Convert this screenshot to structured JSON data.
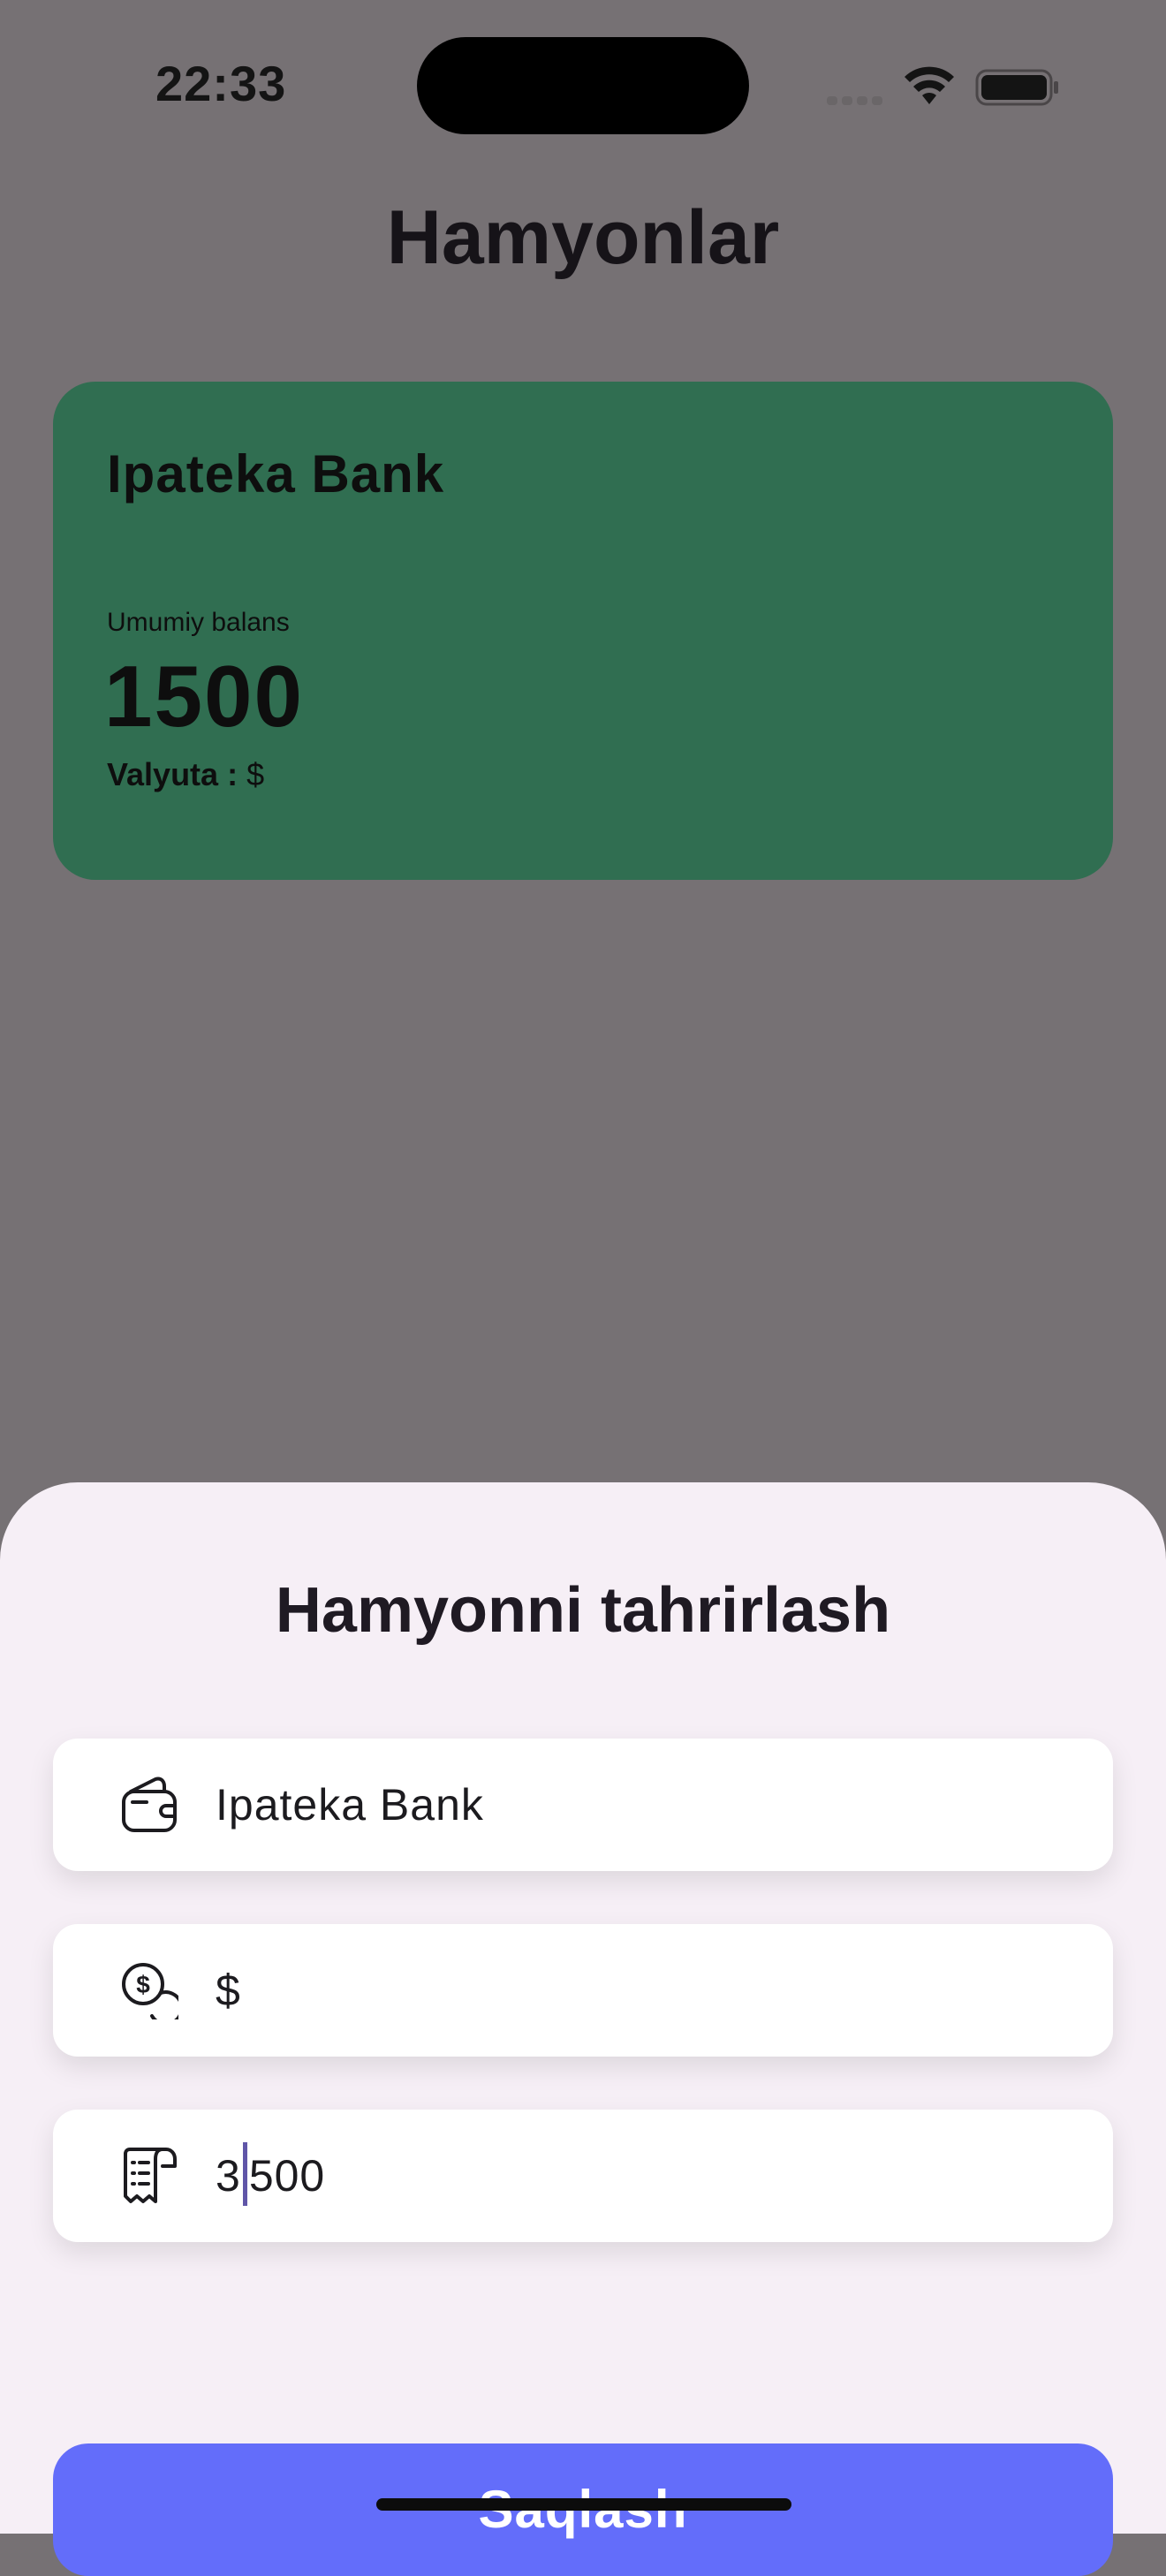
{
  "status_bar": {
    "time": "22:33"
  },
  "header": {
    "title": "Hamyonlar"
  },
  "wallet_card": {
    "name": "Ipateka Bank",
    "balance_label": "Umumiy balans",
    "balance": "1500",
    "currency_label": "Valyuta :",
    "currency": "$",
    "color": "#306e51"
  },
  "edit_sheet": {
    "title": "Hamyonni tahrirlash",
    "name_field": {
      "value": "Ipateka Bank",
      "icon": "wallet-icon"
    },
    "currency_field": {
      "value": "$",
      "icon": "dollar-coins-icon"
    },
    "amount_field": {
      "value_before_caret": "3",
      "value_after_caret": "500",
      "icon": "receipt-icon"
    },
    "save_label": "Saqlash",
    "accent": "#636dfa"
  }
}
